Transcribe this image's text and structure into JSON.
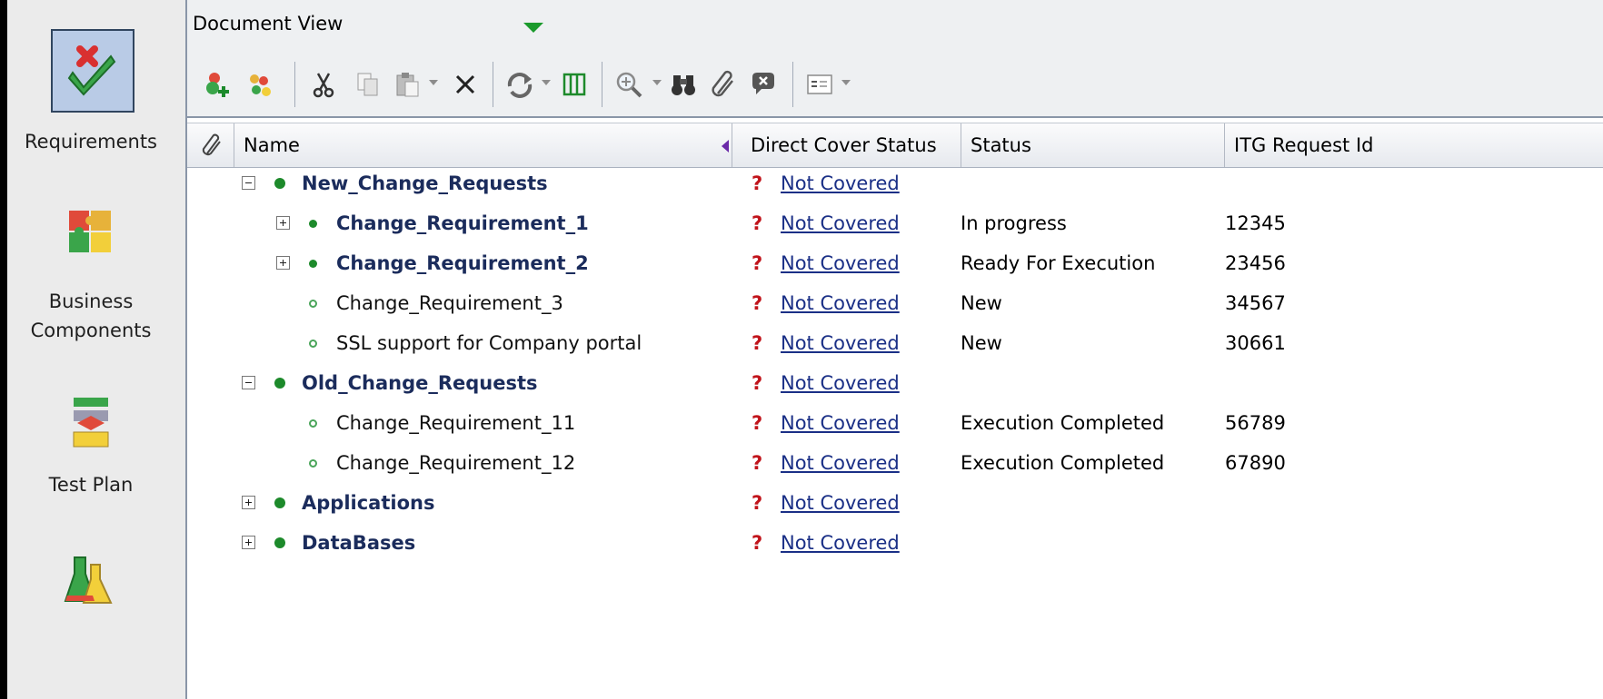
{
  "sidebar": {
    "items": [
      {
        "label": "Requirements",
        "icon": "requirements-icon",
        "selected": true
      },
      {
        "label": "Business Components",
        "icon": "business-components-icon",
        "selected": false
      },
      {
        "label": "Test Plan",
        "icon": "test-plan-icon",
        "selected": false
      },
      {
        "label": "",
        "icon": "test-lab-icon",
        "selected": false
      }
    ]
  },
  "view_selector": {
    "label": "Document View"
  },
  "toolbar": {
    "buttons": [
      "new-requirement-icon",
      "new-folder-icon",
      "cut-icon",
      "copy-icon",
      "paste-icon",
      "delete-icon",
      "refresh-icon",
      "columns-icon",
      "zoom-icon",
      "find-icon",
      "attachment-icon",
      "replace-icon",
      "view-options-icon"
    ]
  },
  "grid": {
    "columns": [
      "Name",
      "Direct Cover Status",
      "Status",
      "ITG Request Id"
    ],
    "rows": [
      {
        "name": "New_Change_Requests",
        "cover": "Not Covered",
        "status": "",
        "itg": ""
      },
      {
        "name": "Change_Requirement_1",
        "cover": "Not Covered",
        "status": "In progress",
        "itg": "12345"
      },
      {
        "name": "Change_Requirement_2",
        "cover": "Not Covered",
        "status": "Ready For Execution",
        "itg": "23456"
      },
      {
        "name": "Change_Requirement_3",
        "cover": "Not Covered",
        "status": "New",
        "itg": "34567"
      },
      {
        "name": "SSL support for Company portal",
        "cover": "Not Covered",
        "status": "New",
        "itg": "30661"
      },
      {
        "name": "Old_Change_Requests",
        "cover": "Not Covered",
        "status": "",
        "itg": ""
      },
      {
        "name": "Change_Requirement_11",
        "cover": "Not Covered",
        "status": "Execution Completed",
        "itg": "56789"
      },
      {
        "name": "Change_Requirement_12",
        "cover": "Not Covered",
        "status": "Execution Completed",
        "itg": "67890"
      },
      {
        "name": "Applications",
        "cover": "Not Covered",
        "status": "",
        "itg": ""
      },
      {
        "name": "DataBases",
        "cover": "Not Covered",
        "status": "",
        "itg": ""
      }
    ]
  },
  "colors": {
    "folder_text": "#1b2c5c",
    "link": "#1a2f86",
    "question_mark": "#c1141b",
    "bullet": "#1d8a2b",
    "selected_tile": "#b9cbe6"
  }
}
